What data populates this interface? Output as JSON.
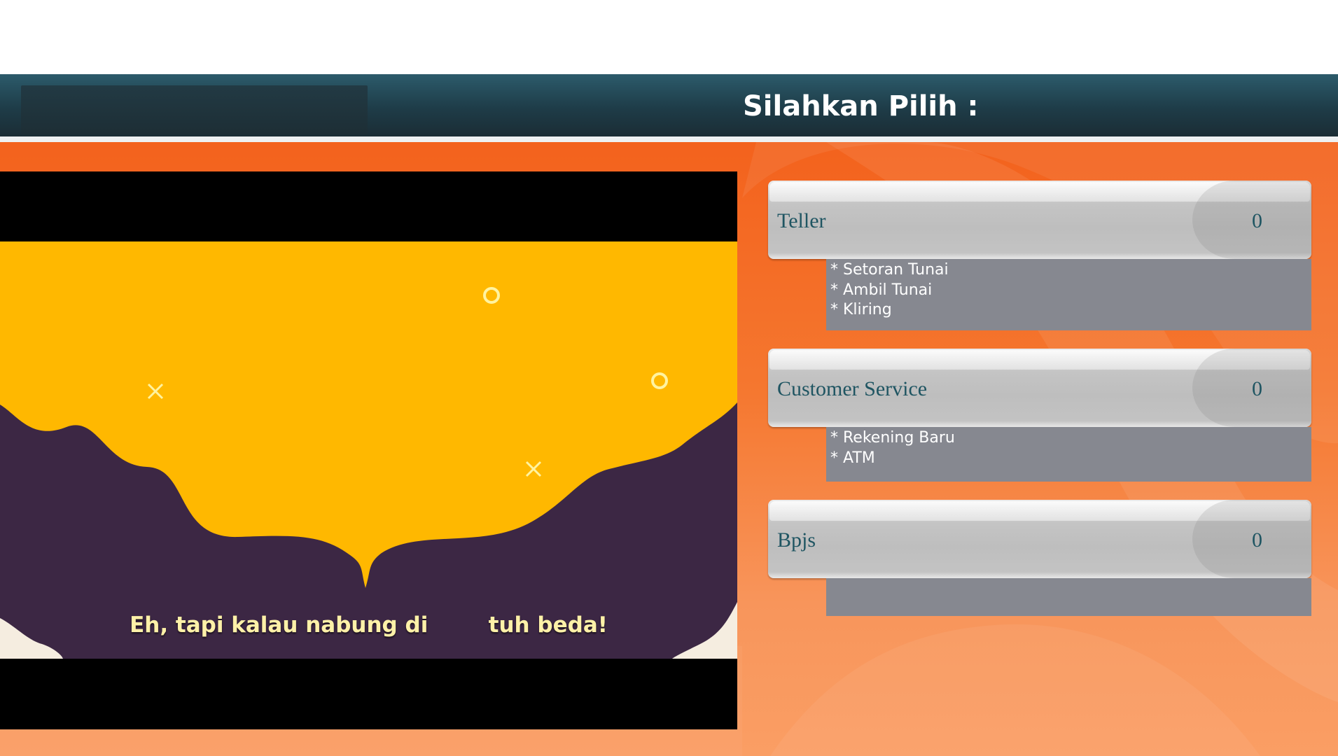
{
  "header": {
    "title": "Silahkan Pilih :"
  },
  "video": {
    "subtitle": "Eh, tapi kalau nabung di        tuh beda!"
  },
  "services": [
    {
      "name": "Teller",
      "count": "0",
      "items": [
        "* Setoran Tunai",
        "* Ambil Tunai",
        "* Kliring"
      ]
    },
    {
      "name": "Customer Service",
      "count": "0",
      "items": [
        "* Rekening Baru",
        "* ATM"
      ]
    },
    {
      "name": "Bpjs",
      "count": "0",
      "items": []
    }
  ],
  "colors": {
    "header": "#1e3c48",
    "background": "#f3621d",
    "service_text": "#1f5562",
    "desc_box": "#868890",
    "video_yellow": "#ffb800",
    "video_purple": "#3c2744"
  }
}
